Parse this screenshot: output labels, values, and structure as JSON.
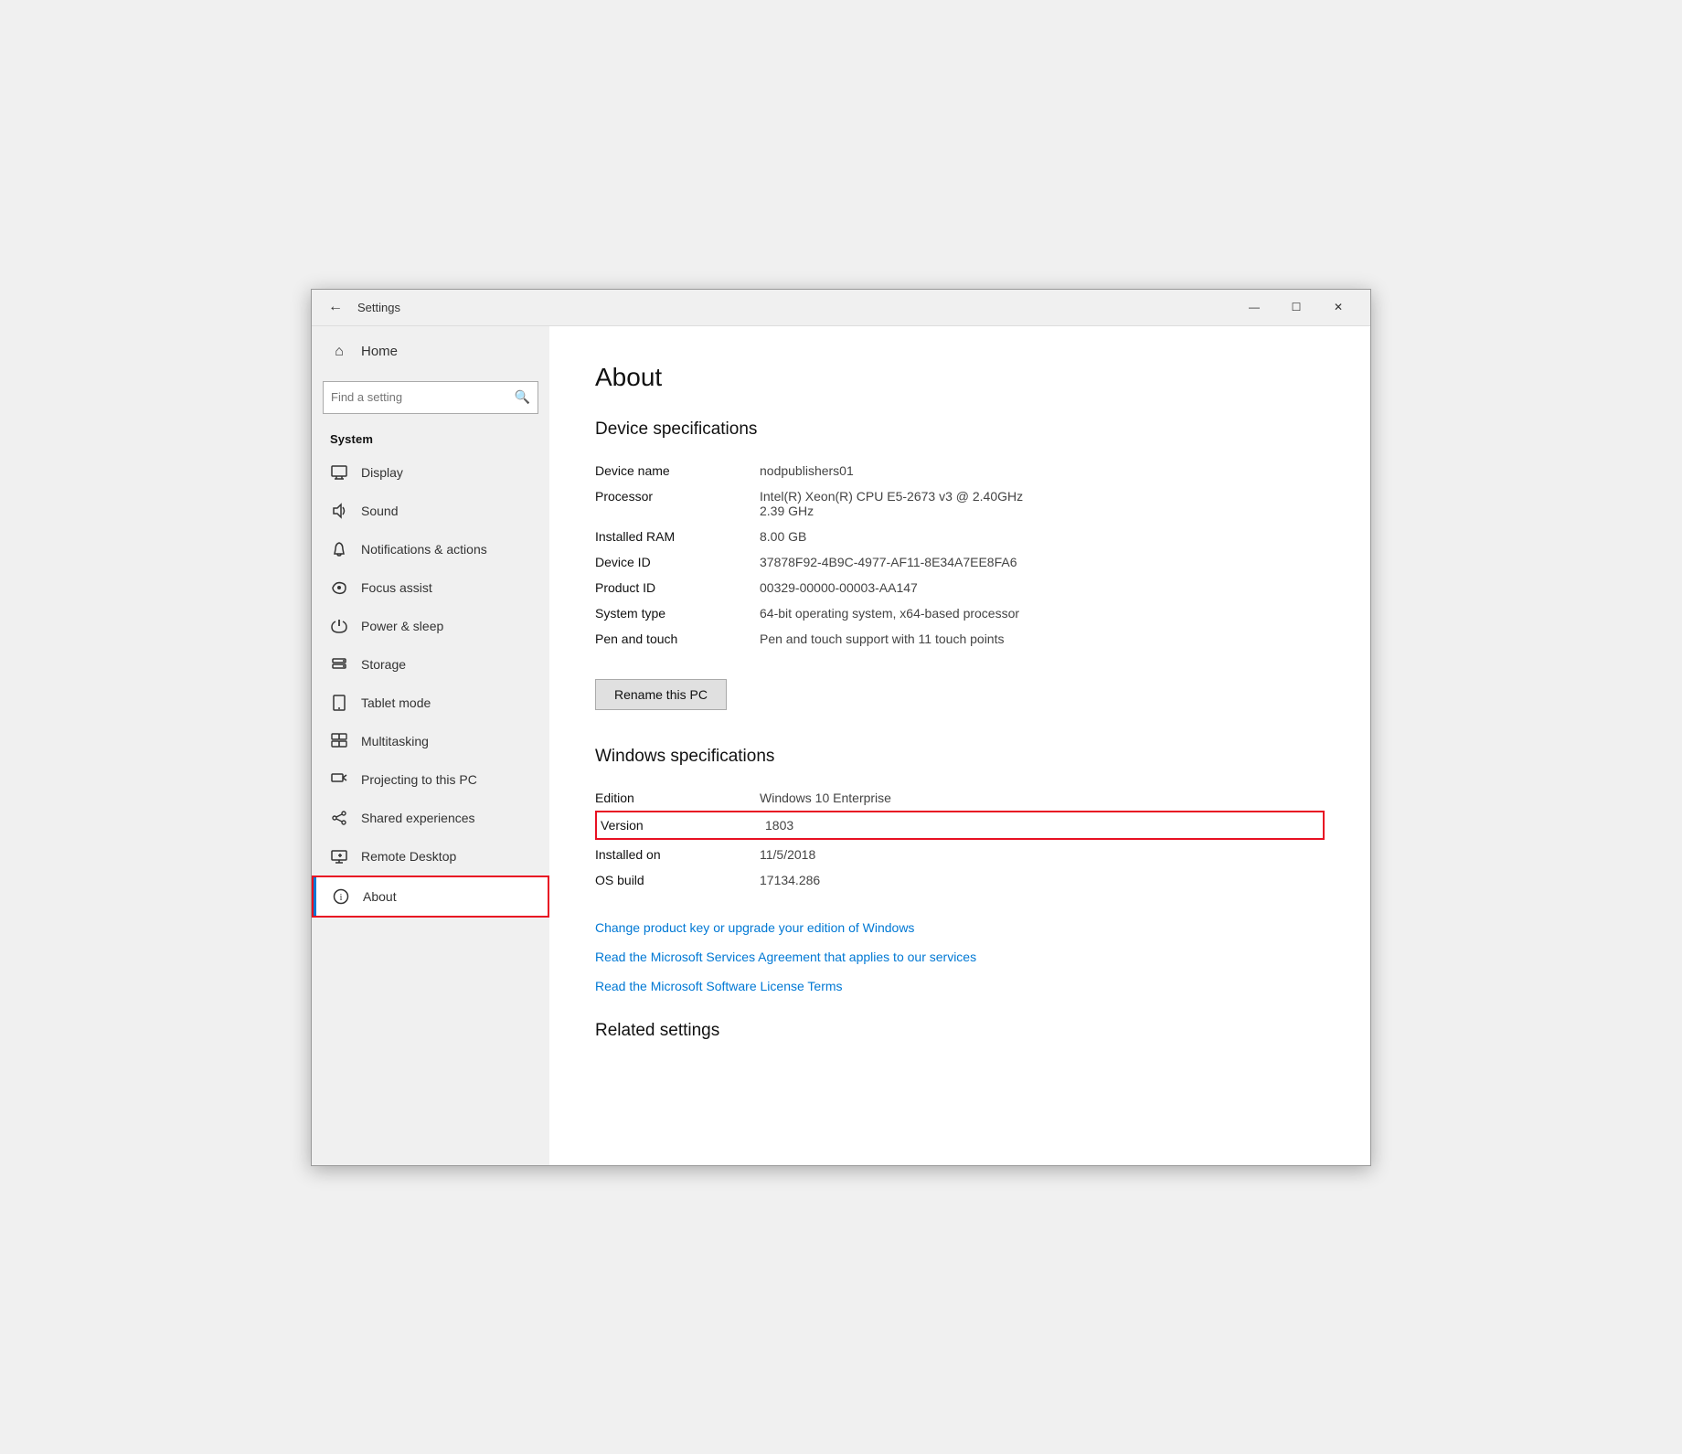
{
  "window": {
    "title": "Settings",
    "controls": {
      "minimize": "—",
      "maximize": "☐",
      "close": "✕"
    }
  },
  "sidebar": {
    "back_label": "←",
    "title": "Settings",
    "search_placeholder": "Find a setting",
    "home_label": "Home",
    "section_label": "System",
    "items": [
      {
        "id": "display",
        "label": "Display",
        "icon": "🖥"
      },
      {
        "id": "sound",
        "label": "Sound",
        "icon": "🔊"
      },
      {
        "id": "notifications",
        "label": "Notifications & actions",
        "icon": "🔔"
      },
      {
        "id": "focus",
        "label": "Focus assist",
        "icon": "🌙"
      },
      {
        "id": "power",
        "label": "Power & sleep",
        "icon": "⏻"
      },
      {
        "id": "storage",
        "label": "Storage",
        "icon": "🗄"
      },
      {
        "id": "tablet",
        "label": "Tablet mode",
        "icon": "📱"
      },
      {
        "id": "multitasking",
        "label": "Multitasking",
        "icon": "⊞"
      },
      {
        "id": "projecting",
        "label": "Projecting to this PC",
        "icon": "📽"
      },
      {
        "id": "shared",
        "label": "Shared experiences",
        "icon": "✂"
      },
      {
        "id": "remote",
        "label": "Remote Desktop",
        "icon": "✕"
      },
      {
        "id": "about",
        "label": "About",
        "icon": "ℹ"
      }
    ]
  },
  "main": {
    "page_title": "About",
    "device_specs_heading": "Device specifications",
    "specs": [
      {
        "label": "Device name",
        "value": "nodpublishers01"
      },
      {
        "label": "Processor",
        "value": "Intel(R) Xeon(R) CPU E5-2673 v3 @ 2.40GHz\n2.39 GHz"
      },
      {
        "label": "Installed RAM",
        "value": "8.00 GB"
      },
      {
        "label": "Device ID",
        "value": "37878F92-4B9C-4977-AF11-8E34A7EE8FA6"
      },
      {
        "label": "Product ID",
        "value": "00329-00000-00003-AA147"
      },
      {
        "label": "System type",
        "value": "64-bit operating system, x64-based processor"
      },
      {
        "label": "Pen and touch",
        "value": "Pen and touch support with 11 touch points"
      }
    ],
    "rename_btn_label": "Rename this PC",
    "windows_specs_heading": "Windows specifications",
    "win_specs": [
      {
        "label": "Edition",
        "value": "Windows 10 Enterprise",
        "highlight": false
      },
      {
        "label": "Version",
        "value": "1803",
        "highlight": true
      },
      {
        "label": "Installed on",
        "value": "11/5/2018",
        "highlight": false
      },
      {
        "label": "OS build",
        "value": "17134.286",
        "highlight": false
      }
    ],
    "links": [
      "Change product key or upgrade your edition of Windows",
      "Read the Microsoft Services Agreement that applies to our services",
      "Read the Microsoft Software License Terms"
    ],
    "related_settings_heading": "Related settings"
  }
}
